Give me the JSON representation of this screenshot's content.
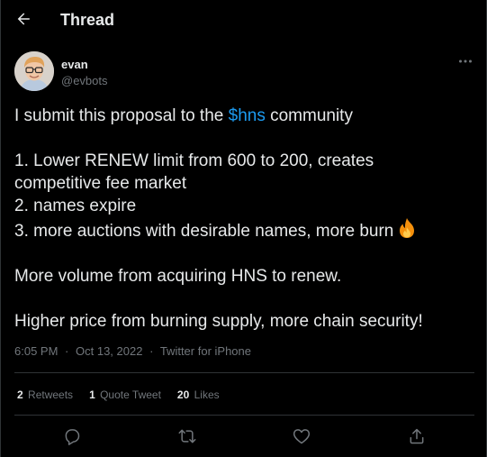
{
  "header": {
    "title": "Thread",
    "back_icon": "arrow-left-icon"
  },
  "author": {
    "name": "evan",
    "handle": "@evbots",
    "avatar_icon": "user-avatar"
  },
  "tweet": {
    "line1_prefix": "I submit this proposal to the ",
    "hashtag": "$hns",
    "line1_suffix": " community",
    "item1_a": "1. Lower RENEW limit from 600 to 200, creates",
    "item1_b": "competitive fee market",
    "item2": "2. names expire",
    "item3": "3. more auctions with desirable names, more burn",
    "fire_icon": "fire-emoji",
    "para2": "More volume from acquiring HNS to renew.",
    "para3": "Higher price from burning supply, more chain security!"
  },
  "meta": {
    "time": "6:05 PM",
    "separator": "·",
    "date": "Oct 13, 2022",
    "source": "Twitter for iPhone"
  },
  "stats": {
    "retweets_count": "2",
    "retweets_label": "Retweets",
    "quotes_count": "1",
    "quotes_label": "Quote Tweet",
    "likes_count": "20",
    "likes_label": "Likes"
  },
  "actions": [
    "reply-icon",
    "retweet-icon",
    "like-icon",
    "share-icon"
  ],
  "colors": {
    "background": "#000000",
    "text": "#e7e9ea",
    "muted": "#71767b",
    "accent": "#1d9bf0",
    "border": "#2f3336"
  }
}
